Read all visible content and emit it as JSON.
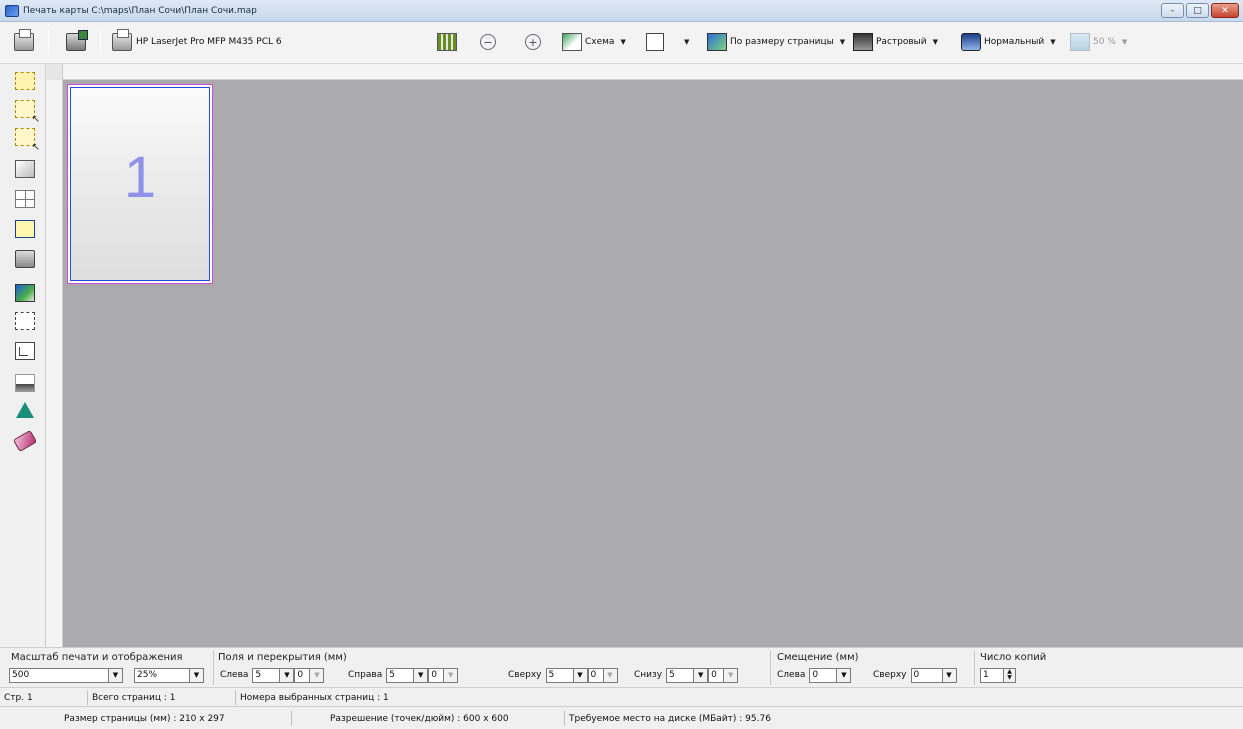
{
  "window": {
    "title": "Печать карты C:\\maps\\План Сочи\\План Сочи.map",
    "minimize": "–",
    "maximize": "□",
    "close": "✕"
  },
  "toolbar": {
    "printer_name": "HP LaserJet Pro MFP M435 PCL 6",
    "zoom_out": "−",
    "zoom_in": "+",
    "scheme_label": "Схема",
    "fit_label": "По размеру страницы",
    "raster_label": "Растровый",
    "normal_label": "Нормальный",
    "transparency_label": "50 %",
    "caret": "▼"
  },
  "left_toolbar": {
    "icons": [
      "select-area-icon",
      "select-area-cursor-icon",
      "select-area-move-icon",
      "frame-icon",
      "pages-grid-icon",
      "page-border-icon",
      "printer-setup-icon",
      "color-icon",
      "page-dash-icon",
      "page-resize-icon",
      "ink-fill-icon",
      "mirror-icon",
      "eraser-icon"
    ]
  },
  "workspace": {
    "page_number": "1",
    "colors": {
      "background": "#abaaad",
      "page_frame": "#d24bd6",
      "page_border": "#2b46d8",
      "page_number_color": "#8f92e8"
    }
  },
  "controls": {
    "scale_group": {
      "label": "Масштаб печати и отображения",
      "scale_value": "500",
      "zoom_value": "25%"
    },
    "margins_group": {
      "label": "Поля и перекрытия (мм)",
      "left_label": "Слева",
      "left_value": "5",
      "left_overlap": "0",
      "right_label": "Справа",
      "right_value": "5",
      "right_overlap": "0",
      "top_label": "Сверху",
      "top_value": "5",
      "top_overlap": "0",
      "bottom_label": "Снизу",
      "bottom_value": "5",
      "bottom_overlap": "0"
    },
    "offset_group": {
      "label": "Смещение (мм)",
      "left_label": "Слева",
      "left_value": "0",
      "top_label": "Сверху",
      "top_value": "0"
    },
    "copies_group": {
      "label": "Число копий",
      "value": "1"
    }
  },
  "status": {
    "page": "Стр. 1",
    "total_pages": "Всего страниц : 1",
    "selected_pages": "Номера выбранных страниц : 1",
    "page_size": "Размер страницы (мм) : 210 x 297",
    "resolution": "Разрешение (точек/дюйм) : 600 x 600",
    "disk_space": "Требуемое место на диске (МБайт) : 95.76"
  }
}
